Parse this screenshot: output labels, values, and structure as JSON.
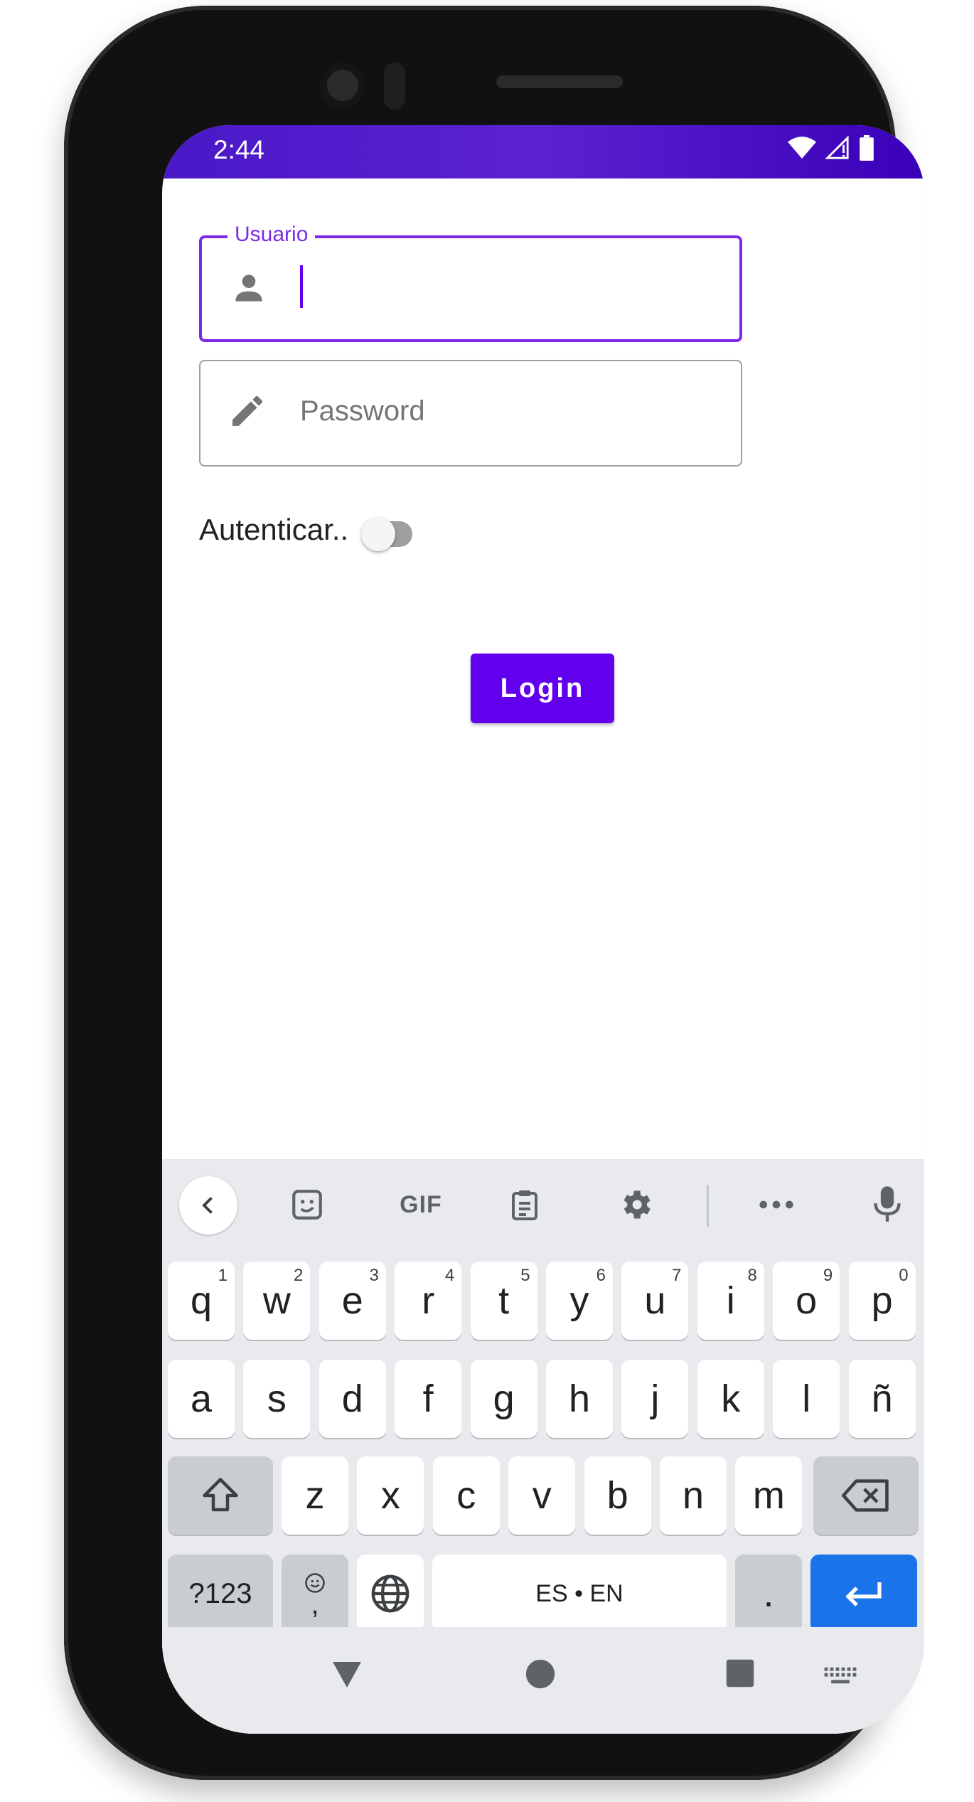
{
  "status_bar": {
    "time": "2:44"
  },
  "form": {
    "user_label": "Usuario",
    "user_value": "",
    "password_placeholder": "Password",
    "switch_label": "Autenticar..",
    "switch_on": false,
    "login_label": "Login"
  },
  "keyboard": {
    "toolbar": {
      "gif_label": "GIF"
    },
    "row1": [
      {
        "k": "q",
        "n": "1"
      },
      {
        "k": "w",
        "n": "2"
      },
      {
        "k": "e",
        "n": "3"
      },
      {
        "k": "r",
        "n": "4"
      },
      {
        "k": "t",
        "n": "5"
      },
      {
        "k": "y",
        "n": "6"
      },
      {
        "k": "u",
        "n": "7"
      },
      {
        "k": "i",
        "n": "8"
      },
      {
        "k": "o",
        "n": "9"
      },
      {
        "k": "p",
        "n": "0"
      }
    ],
    "row2": [
      "a",
      "s",
      "d",
      "f",
      "g",
      "h",
      "j",
      "k",
      "l",
      "ñ"
    ],
    "row3": [
      "z",
      "x",
      "c",
      "v",
      "b",
      "n",
      "m"
    ],
    "symbols_label": "?123",
    "comma_label": ",",
    "space_label": "ES • EN",
    "period_label": "."
  },
  "colors": {
    "accent": "#6200ee",
    "field_focus": "#7d2ae8",
    "status_bar": "#4a18c8",
    "enter_key": "#1a73e8"
  }
}
